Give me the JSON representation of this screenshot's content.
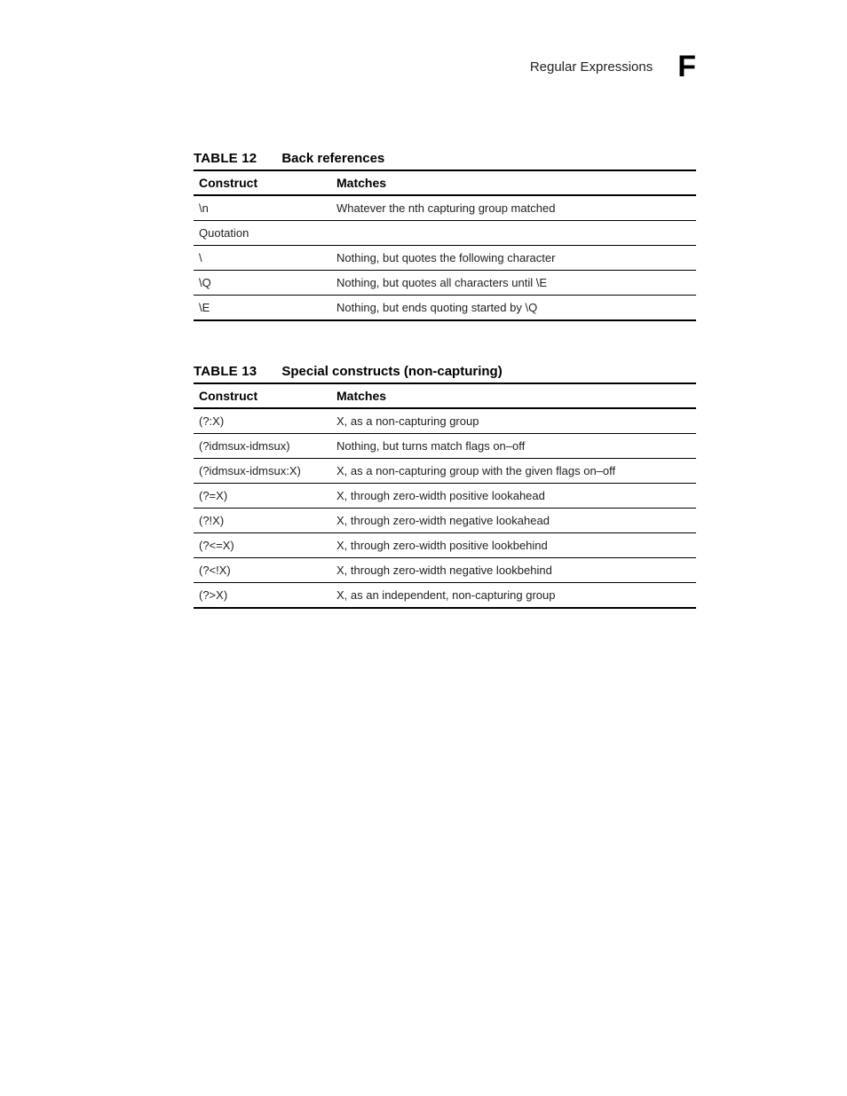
{
  "header": {
    "title": "Regular Expressions",
    "section_letter": "F"
  },
  "tables": [
    {
      "number": "TABLE 12",
      "title": "Back references",
      "columns": [
        "Construct",
        "Matches"
      ],
      "rows": [
        {
          "c0": "\\n",
          "c1": "Whatever the nth capturing group matched"
        },
        {
          "c0": "Quotation",
          "c1": ""
        },
        {
          "c0": "\\",
          "c1": "Nothing, but quotes the following character"
        },
        {
          "c0": "\\Q",
          "c1": "Nothing, but quotes all characters until \\E"
        },
        {
          "c0": "\\E",
          "c1": "Nothing, but ends quoting started by \\Q"
        }
      ]
    },
    {
      "number": "TABLE 13",
      "title": "Special constructs (non-capturing)",
      "columns": [
        "Construct",
        "Matches"
      ],
      "rows": [
        {
          "c0": "(?:X)",
          "c1": "X, as a non-capturing group"
        },
        {
          "c0": "(?idmsux-idmsux)",
          "c1": "Nothing, but turns match flags on–off"
        },
        {
          "c0": "(?idmsux-idmsux:X)",
          "c1": "X, as a non-capturing group with the given flags on–off"
        },
        {
          "c0": "(?=X)",
          "c1": "X, through zero-width positive lookahead"
        },
        {
          "c0": "(?!X)",
          "c1": "X, through zero-width negative lookahead"
        },
        {
          "c0": "(?<=X)",
          "c1": "X, through zero-width positive lookbehind"
        },
        {
          "c0": "(?<!X)",
          "c1": "X, through zero-width negative lookbehind"
        },
        {
          "c0": "(?>X)",
          "c1": "X, as an independent, non-capturing group"
        }
      ]
    }
  ]
}
